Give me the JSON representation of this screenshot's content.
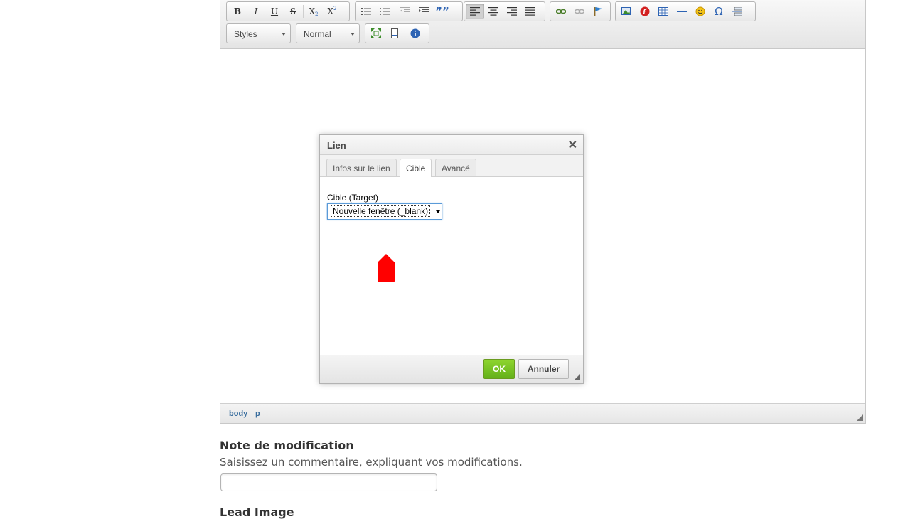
{
  "toolbar": {
    "styles_label": "Styles",
    "format_label": "Normal",
    "buttons": {
      "bold": "B",
      "italic": "I",
      "underline": "U",
      "strike": "S",
      "subscript": "X",
      "superscript": "X",
      "blockquote": "””",
      "special_char": "Ω"
    }
  },
  "statusbar": {
    "crumbs": [
      "body",
      "p"
    ]
  },
  "dialog": {
    "title": "Lien",
    "close_glyph": "✕",
    "tabs": [
      "Infos sur le lien",
      "Cible",
      "Avancé"
    ],
    "active_tab": "Cible",
    "target_label": "Cible (Target)",
    "target_value": "Nouvelle fenêtre (_blank)",
    "ok_label": "OK",
    "cancel_label": "Annuler"
  },
  "form": {
    "note_title": "Note de modification",
    "note_help": "Saisissez un commentaire, expliquant vos modifications.",
    "note_value": "",
    "lead_image_title": "Lead Image"
  },
  "colors": {
    "ok_button": "#7cc326",
    "cursor_marker": "#ff0000",
    "breadcrumb": "#3a6e9e"
  }
}
